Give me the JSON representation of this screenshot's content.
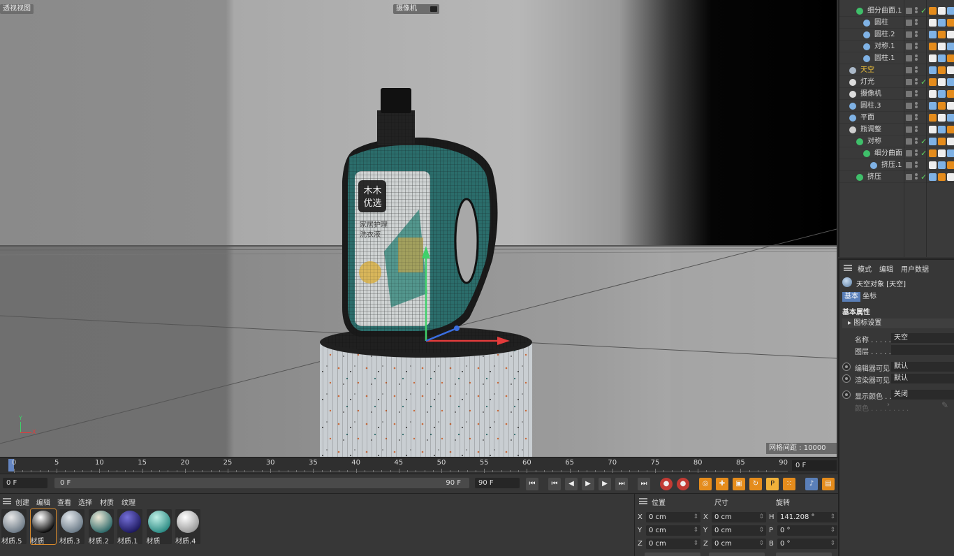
{
  "viewport": {
    "title": "透视视图",
    "camera_label": "摄像机",
    "grid_spacing": "网格间距 : 10000 cm",
    "product_text": {
      "brand_top": "木木",
      "brand_bottom": "优选",
      "line1": "家居护理",
      "line2": "洗衣液"
    },
    "axis_y": "Y",
    "axis_x": "X"
  },
  "object_manager": {
    "items": [
      {
        "name": "细分曲面.1",
        "indent": 1,
        "icon": "subdivision-icon",
        "color": "#3fbf6a",
        "check": true
      },
      {
        "name": "圆柱",
        "indent": 2,
        "icon": "cylinder-icon",
        "color": "#7fb2e5",
        "check": false
      },
      {
        "name": "圆柱.2",
        "indent": 2,
        "icon": "cylinder-icon",
        "color": "#7fb2e5",
        "check": false
      },
      {
        "name": "对称.1",
        "indent": 2,
        "icon": "symmetry-icon",
        "color": "#7fb2e5",
        "check": false
      },
      {
        "name": "圆柱.1",
        "indent": 2,
        "icon": "cylinder-icon",
        "color": "#7fb2e5",
        "check": false
      },
      {
        "name": "天空",
        "indent": 0,
        "icon": "sky-icon",
        "color": "#aab8c8",
        "check": false,
        "highlight": true
      },
      {
        "name": "灯光",
        "indent": 0,
        "icon": "light-icon",
        "color": "#dddddd",
        "check": true
      },
      {
        "name": "摄像机",
        "indent": 0,
        "icon": "camera-icon",
        "color": "#dddddd",
        "check": false
      },
      {
        "name": "圆柱.3",
        "indent": 0,
        "icon": "cylinder-icon",
        "color": "#7fb2e5",
        "check": false
      },
      {
        "name": "平面",
        "indent": 0,
        "icon": "plane-icon",
        "color": "#7fb2e5",
        "check": false
      },
      {
        "name": "瓶调整",
        "indent": 0,
        "icon": "null-icon",
        "color": "#cfcfcf",
        "check": false
      },
      {
        "name": "对称",
        "indent": 1,
        "icon": "symmetry-icon",
        "color": "#3fbf6a",
        "check": true
      },
      {
        "name": "细分曲面",
        "indent": 2,
        "icon": "subdivision-icon",
        "color": "#3fbf6a",
        "check": true
      },
      {
        "name": "挤压.1",
        "indent": 3,
        "icon": "extrude-icon",
        "color": "#7fb2e5",
        "check": false
      },
      {
        "name": "挤压",
        "indent": 1,
        "icon": "extrude-icon",
        "color": "#3fbf6a",
        "check": true
      }
    ]
  },
  "attribute_manager": {
    "menu": [
      "模式",
      "编辑",
      "用户数据"
    ],
    "title": "天空对象 [天空]",
    "tabs": [
      "基本",
      "坐标"
    ],
    "section": "基本属性",
    "icon_settings": "图标设置",
    "fields": {
      "name_label": "名称 . . . . . . . . .",
      "name_value": "天空",
      "layer_label": "图层 . . . . . . . . .",
      "layer_value": "",
      "editor_visible_label": "编辑器可见",
      "editor_visible_value": "默认",
      "render_visible_label": "渲染器可见",
      "render_visible_value": "默认",
      "display_color_label": "显示颜色 . .",
      "display_color_value": "关闭",
      "color_label": "颜色 . . . . . . . . ."
    }
  },
  "timeline": {
    "ticks": [
      "0",
      "5",
      "10",
      "15",
      "20",
      "25",
      "30",
      "35",
      "40",
      "45",
      "50",
      "55",
      "60",
      "65",
      "70",
      "75",
      "80",
      "85",
      "90"
    ],
    "current_frame": "0 F"
  },
  "transport": {
    "start_frame": "0 F",
    "range_start": "0 F",
    "range_end": "90 F",
    "end_frame": "90 F"
  },
  "material_manager": {
    "menu": [
      "创建",
      "编辑",
      "查看",
      "选择",
      "材质",
      "纹理"
    ],
    "materials": [
      {
        "name": "材质.5",
        "c1": "#e8e8e8",
        "c2": "#6d7a86"
      },
      {
        "name": "材质",
        "c1": "#ffffff",
        "c2": "#0b0b0b",
        "selected": true
      },
      {
        "name": "材质.3",
        "c1": "#e4e8ec",
        "c2": "#6c7b88"
      },
      {
        "name": "材质.2",
        "c1": "#f0ebd8",
        "c2": "#2f6a6a"
      },
      {
        "name": "材质.1",
        "c1": "#7570d9",
        "c2": "#1e1a5f"
      },
      {
        "name": "材质",
        "c1": "#bff0e6",
        "c2": "#2e8c85"
      },
      {
        "name": "材质.4",
        "c1": "#ffffff",
        "c2": "#9a9a9a"
      }
    ]
  },
  "coordinates": {
    "headers": [
      "位置",
      "尺寸",
      "旋转"
    ],
    "rows": [
      {
        "a1": "X",
        "v1": "0 cm",
        "a2": "X",
        "v2": "0 cm",
        "a3": "H",
        "v3": "141.208 °"
      },
      {
        "a1": "Y",
        "v1": "0 cm",
        "a2": "Y",
        "v2": "0 cm",
        "a3": "P",
        "v3": "0 °"
      },
      {
        "a1": "Z",
        "v1": "0 cm",
        "a2": "Z",
        "v2": "0 cm",
        "a3": "B",
        "v3": "0 °"
      }
    ]
  }
}
